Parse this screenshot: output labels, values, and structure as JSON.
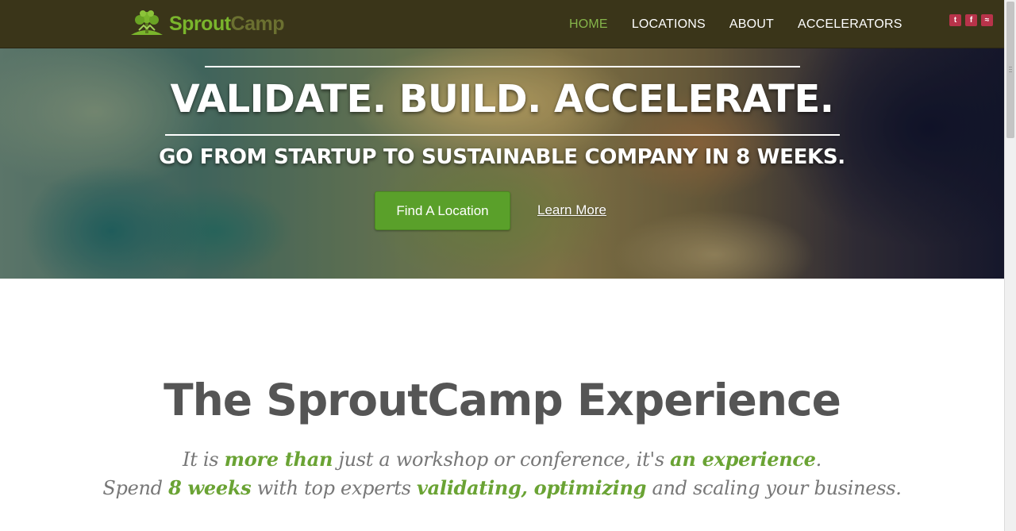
{
  "nav": {
    "brand_part1": "Sprout",
    "brand_part2": "Camp",
    "links": [
      "HOME",
      "LOCATIONS",
      "ABOUT",
      "ACCELERATORS"
    ],
    "active_index": 0,
    "social": [
      {
        "icon": "twitter-icon",
        "glyph": "t"
      },
      {
        "icon": "facebook-icon",
        "glyph": "f"
      },
      {
        "icon": "rss-icon",
        "glyph": "≈"
      }
    ]
  },
  "hero": {
    "title": "VALIDATE. BUILD. ACCELERATE.",
    "subtitle": "GO FROM STARTUP TO SUSTAINABLE COMPANY IN 8 WEEKS.",
    "cta_label": "Find A Location",
    "learn_more_label": "Learn More"
  },
  "main": {
    "title": "The SproutCamp Experience",
    "line1": {
      "p1": "It is ",
      "h1": "more than",
      "p2": " just a workshop or conference, it's ",
      "h2": "an experience",
      "p3": "."
    },
    "line2": {
      "p1": "Spend ",
      "h1": "8 weeks",
      "p2": " with top experts ",
      "h2": "validating, optimizing",
      "p3": " and scaling your business."
    }
  },
  "colors": {
    "nav_bg": "#3a3519",
    "accent_green": "#6aa334",
    "button_green": "#5aa02a",
    "social_red": "#b8334a"
  }
}
